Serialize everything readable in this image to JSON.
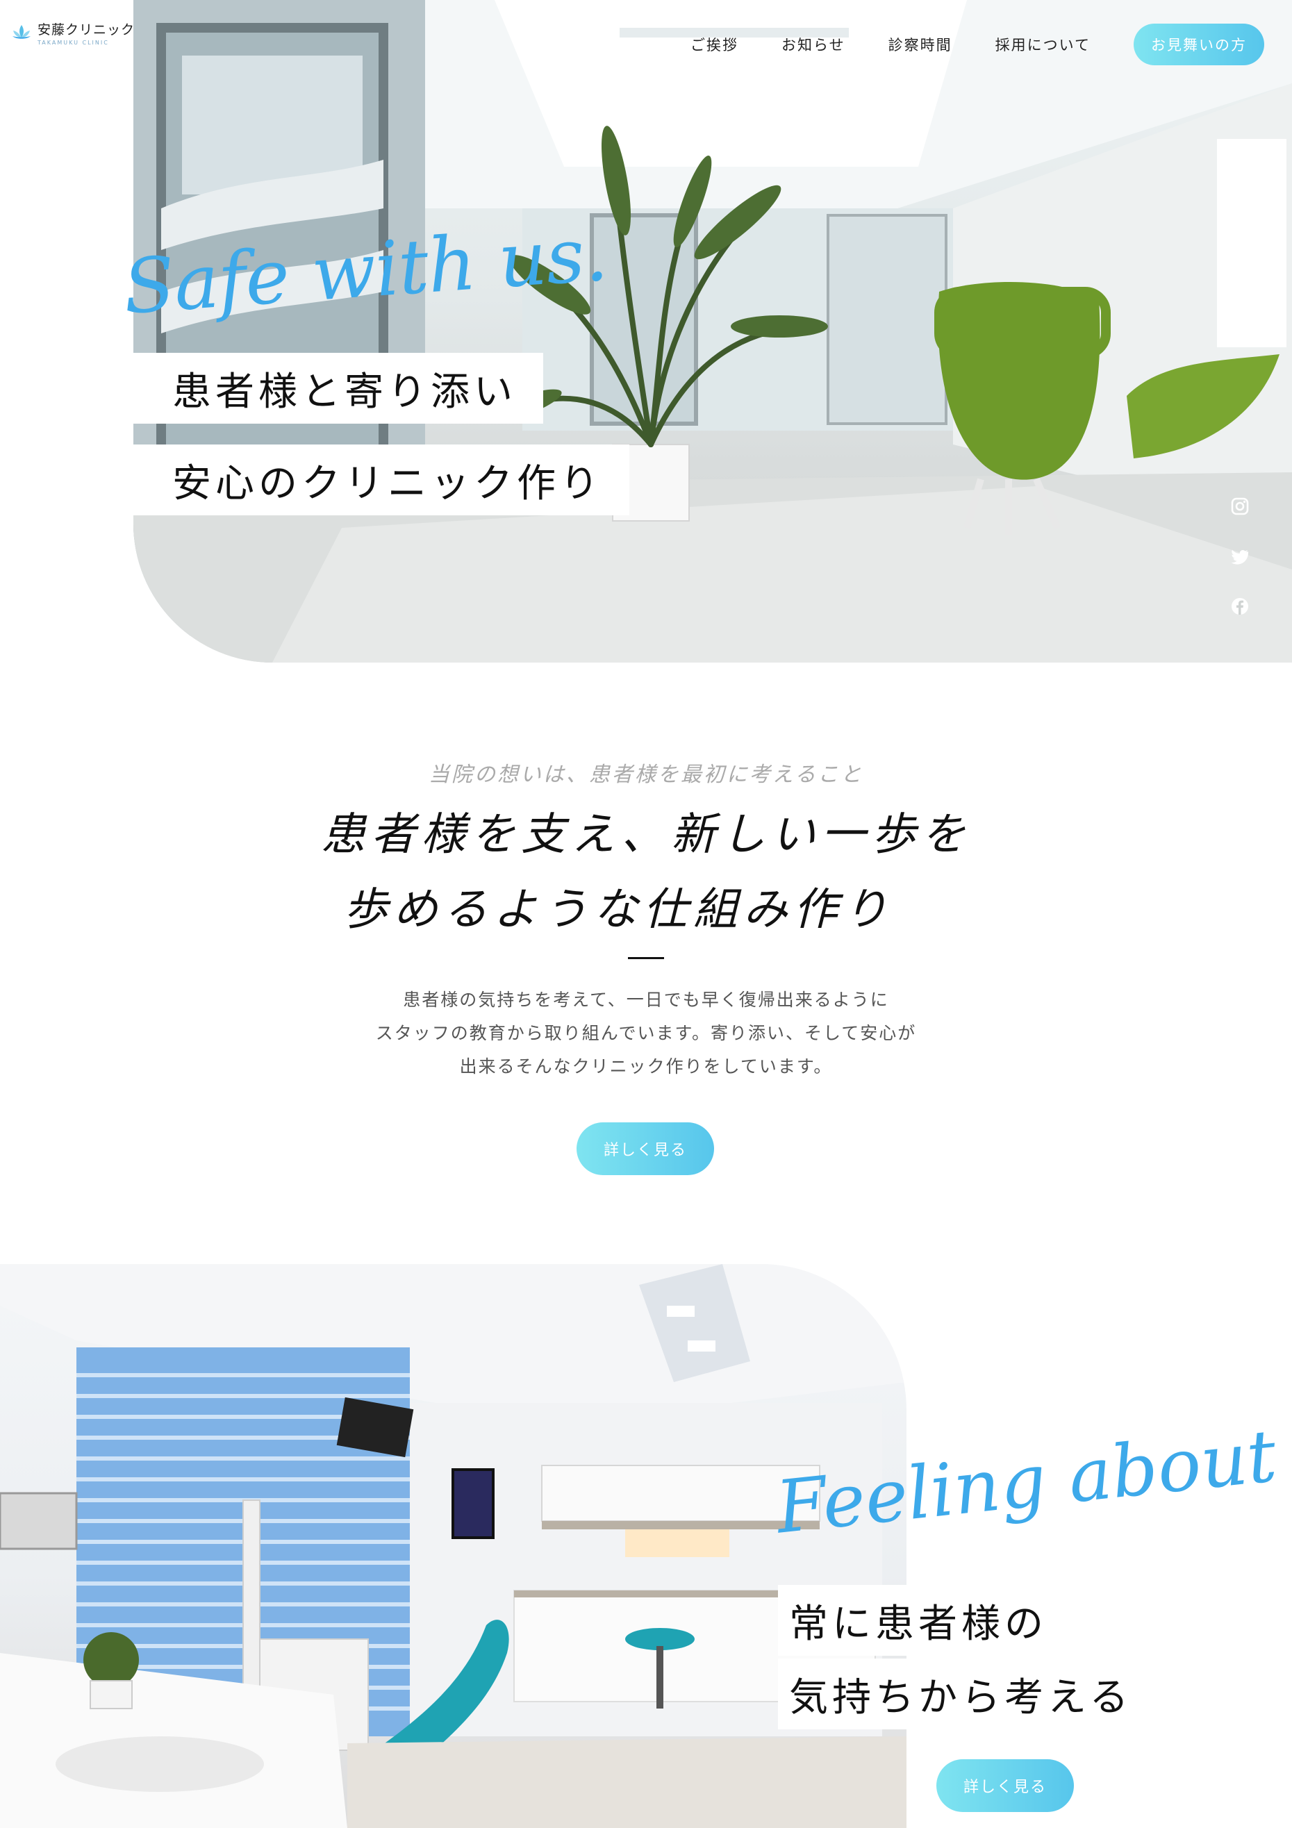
{
  "header": {
    "logo_title": "安藤クリニック",
    "logo_sub": "TAKAMUKU CLINIC",
    "nav": [
      "ご挨拶",
      "お知らせ",
      "診察時間",
      "採用について"
    ],
    "cta": "お見舞いの方"
  },
  "hero": {
    "script": "Safe with us.",
    "line1": "患者様と寄り添い",
    "line2": "安心のクリニック作り",
    "social_icons": [
      "instagram-icon",
      "twitter-icon",
      "facebook-icon"
    ]
  },
  "intro": {
    "eyebrow": "当院の想いは、患者様を最初に考えること",
    "heading1": "患者様を支え、新しい一歩を",
    "heading2": "歩めるような仕組み作り",
    "body1": "患者様の気持ちを考えて、一日でも早く復帰出来るように",
    "body2": "スタッフの教育から取り組んでいます。寄り添い、そして安心が",
    "body3": "出来るそんなクリニック作りをしています。",
    "button": "詳しく見る"
  },
  "feeling": {
    "script": "Feeling about",
    "line1": "常に患者様の",
    "line2": "気持ちから考える",
    "button": "詳しく見る"
  },
  "colors": {
    "accent": "#3da9ea",
    "button_start": "#7fe4f0",
    "button_end": "#57c6ec"
  }
}
